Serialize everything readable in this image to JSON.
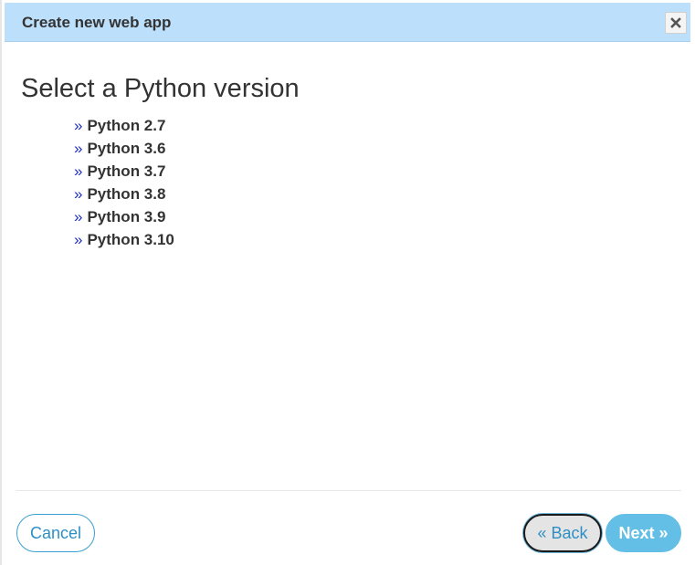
{
  "dialog": {
    "title": "Create new web app",
    "close_icon": "close-x-icon"
  },
  "main": {
    "heading": "Select a Python version",
    "bullet": "»",
    "versions": [
      {
        "label": "Python 2.7"
      },
      {
        "label": "Python 3.6"
      },
      {
        "label": "Python 3.7"
      },
      {
        "label": "Python 3.8"
      },
      {
        "label": "Python 3.9"
      },
      {
        "label": "Python 3.10"
      }
    ]
  },
  "footer": {
    "cancel_label": "Cancel",
    "back_label": "« Back",
    "next_label": "Next »"
  },
  "colors": {
    "titlebar_bg": "#bcdffb",
    "accent": "#2d8fc4",
    "next_bg": "#64bfe6",
    "bullet": "#1f2fbf"
  }
}
